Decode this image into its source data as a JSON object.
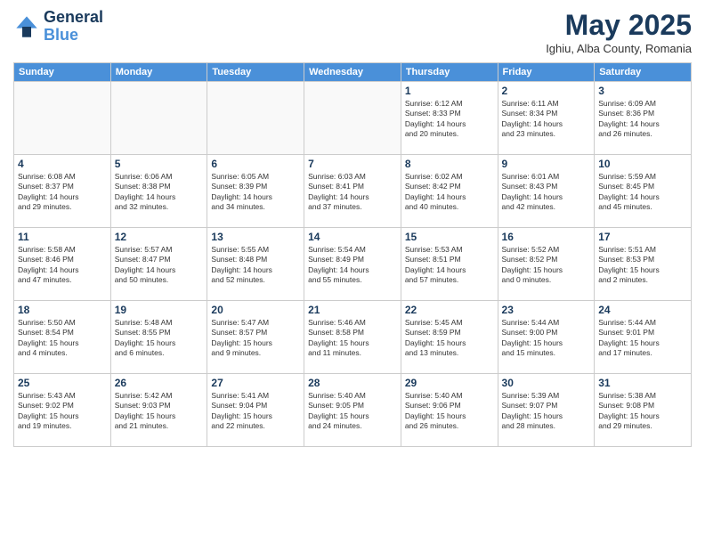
{
  "header": {
    "logo_line1": "General",
    "logo_line2": "Blue",
    "month_title": "May 2025",
    "location": "Ighiu, Alba County, Romania"
  },
  "weekdays": [
    "Sunday",
    "Monday",
    "Tuesday",
    "Wednesday",
    "Thursday",
    "Friday",
    "Saturday"
  ],
  "weeks": [
    [
      {
        "day": "",
        "info": ""
      },
      {
        "day": "",
        "info": ""
      },
      {
        "day": "",
        "info": ""
      },
      {
        "day": "",
        "info": ""
      },
      {
        "day": "1",
        "info": "Sunrise: 6:12 AM\nSunset: 8:33 PM\nDaylight: 14 hours\nand 20 minutes."
      },
      {
        "day": "2",
        "info": "Sunrise: 6:11 AM\nSunset: 8:34 PM\nDaylight: 14 hours\nand 23 minutes."
      },
      {
        "day": "3",
        "info": "Sunrise: 6:09 AM\nSunset: 8:36 PM\nDaylight: 14 hours\nand 26 minutes."
      }
    ],
    [
      {
        "day": "4",
        "info": "Sunrise: 6:08 AM\nSunset: 8:37 PM\nDaylight: 14 hours\nand 29 minutes."
      },
      {
        "day": "5",
        "info": "Sunrise: 6:06 AM\nSunset: 8:38 PM\nDaylight: 14 hours\nand 32 minutes."
      },
      {
        "day": "6",
        "info": "Sunrise: 6:05 AM\nSunset: 8:39 PM\nDaylight: 14 hours\nand 34 minutes."
      },
      {
        "day": "7",
        "info": "Sunrise: 6:03 AM\nSunset: 8:41 PM\nDaylight: 14 hours\nand 37 minutes."
      },
      {
        "day": "8",
        "info": "Sunrise: 6:02 AM\nSunset: 8:42 PM\nDaylight: 14 hours\nand 40 minutes."
      },
      {
        "day": "9",
        "info": "Sunrise: 6:01 AM\nSunset: 8:43 PM\nDaylight: 14 hours\nand 42 minutes."
      },
      {
        "day": "10",
        "info": "Sunrise: 5:59 AM\nSunset: 8:45 PM\nDaylight: 14 hours\nand 45 minutes."
      }
    ],
    [
      {
        "day": "11",
        "info": "Sunrise: 5:58 AM\nSunset: 8:46 PM\nDaylight: 14 hours\nand 47 minutes."
      },
      {
        "day": "12",
        "info": "Sunrise: 5:57 AM\nSunset: 8:47 PM\nDaylight: 14 hours\nand 50 minutes."
      },
      {
        "day": "13",
        "info": "Sunrise: 5:55 AM\nSunset: 8:48 PM\nDaylight: 14 hours\nand 52 minutes."
      },
      {
        "day": "14",
        "info": "Sunrise: 5:54 AM\nSunset: 8:49 PM\nDaylight: 14 hours\nand 55 minutes."
      },
      {
        "day": "15",
        "info": "Sunrise: 5:53 AM\nSunset: 8:51 PM\nDaylight: 14 hours\nand 57 minutes."
      },
      {
        "day": "16",
        "info": "Sunrise: 5:52 AM\nSunset: 8:52 PM\nDaylight: 15 hours\nand 0 minutes."
      },
      {
        "day": "17",
        "info": "Sunrise: 5:51 AM\nSunset: 8:53 PM\nDaylight: 15 hours\nand 2 minutes."
      }
    ],
    [
      {
        "day": "18",
        "info": "Sunrise: 5:50 AM\nSunset: 8:54 PM\nDaylight: 15 hours\nand 4 minutes."
      },
      {
        "day": "19",
        "info": "Sunrise: 5:48 AM\nSunset: 8:55 PM\nDaylight: 15 hours\nand 6 minutes."
      },
      {
        "day": "20",
        "info": "Sunrise: 5:47 AM\nSunset: 8:57 PM\nDaylight: 15 hours\nand 9 minutes."
      },
      {
        "day": "21",
        "info": "Sunrise: 5:46 AM\nSunset: 8:58 PM\nDaylight: 15 hours\nand 11 minutes."
      },
      {
        "day": "22",
        "info": "Sunrise: 5:45 AM\nSunset: 8:59 PM\nDaylight: 15 hours\nand 13 minutes."
      },
      {
        "day": "23",
        "info": "Sunrise: 5:44 AM\nSunset: 9:00 PM\nDaylight: 15 hours\nand 15 minutes."
      },
      {
        "day": "24",
        "info": "Sunrise: 5:44 AM\nSunset: 9:01 PM\nDaylight: 15 hours\nand 17 minutes."
      }
    ],
    [
      {
        "day": "25",
        "info": "Sunrise: 5:43 AM\nSunset: 9:02 PM\nDaylight: 15 hours\nand 19 minutes."
      },
      {
        "day": "26",
        "info": "Sunrise: 5:42 AM\nSunset: 9:03 PM\nDaylight: 15 hours\nand 21 minutes."
      },
      {
        "day": "27",
        "info": "Sunrise: 5:41 AM\nSunset: 9:04 PM\nDaylight: 15 hours\nand 22 minutes."
      },
      {
        "day": "28",
        "info": "Sunrise: 5:40 AM\nSunset: 9:05 PM\nDaylight: 15 hours\nand 24 minutes."
      },
      {
        "day": "29",
        "info": "Sunrise: 5:40 AM\nSunset: 9:06 PM\nDaylight: 15 hours\nand 26 minutes."
      },
      {
        "day": "30",
        "info": "Sunrise: 5:39 AM\nSunset: 9:07 PM\nDaylight: 15 hours\nand 28 minutes."
      },
      {
        "day": "31",
        "info": "Sunrise: 5:38 AM\nSunset: 9:08 PM\nDaylight: 15 hours\nand 29 minutes."
      }
    ]
  ]
}
